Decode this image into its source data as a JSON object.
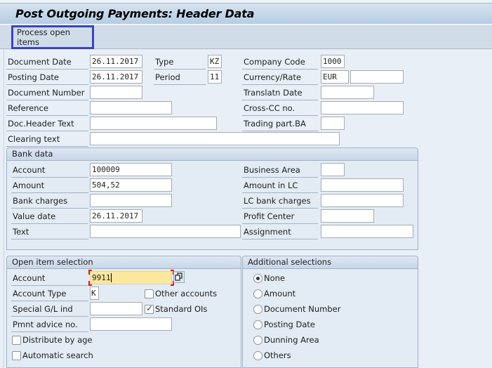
{
  "window": {
    "title": "Post Outgoing Payments: Header Data"
  },
  "toolbar": {
    "process_open_items": "Process open items"
  },
  "header": {
    "document_date": {
      "label": "Document Date",
      "value": "26.11.2017"
    },
    "type": {
      "label": "Type",
      "value": "KZ"
    },
    "company_code": {
      "label": "Company Code",
      "value": "1000"
    },
    "posting_date": {
      "label": "Posting Date",
      "value": "26.11.2017"
    },
    "period": {
      "label": "Period",
      "value": "11"
    },
    "currency_rate": {
      "label": "Currency/Rate",
      "currency": "EUR",
      "rate": ""
    },
    "document_number": {
      "label": "Document Number",
      "value": ""
    },
    "translatn_date": {
      "label": "Translatn Date",
      "value": ""
    },
    "reference": {
      "label": "Reference",
      "value": ""
    },
    "cross_cc_no": {
      "label": "Cross-CC no.",
      "value": ""
    },
    "doc_header_text": {
      "label": "Doc.Header Text",
      "value": ""
    },
    "trading_part_ba": {
      "label": "Trading part.BA",
      "value": ""
    },
    "clearing_text": {
      "label": "Clearing text",
      "value": ""
    }
  },
  "bank_data": {
    "title": "Bank data",
    "account": {
      "label": "Account",
      "value": "100009"
    },
    "amount": {
      "label": "Amount",
      "value": "504,52"
    },
    "bank_charges": {
      "label": "Bank charges",
      "value": ""
    },
    "value_date": {
      "label": "Value date",
      "value": "26.11.2017"
    },
    "text": {
      "label": "Text",
      "value": ""
    },
    "business_area": {
      "label": "Business Area",
      "value": ""
    },
    "amount_in_lc": {
      "label": "Amount in LC",
      "value": ""
    },
    "lc_bank_charges": {
      "label": "LC bank charges",
      "value": ""
    },
    "profit_center": {
      "label": "Profit Center",
      "value": ""
    },
    "assignment": {
      "label": "Assignment",
      "value": ""
    }
  },
  "open_item_selection": {
    "title": "Open item selection",
    "account": {
      "label": "Account",
      "value": "9911"
    },
    "account_type": {
      "label": "Account Type",
      "value": "K"
    },
    "other_accounts": {
      "label": "Other accounts",
      "checked": false
    },
    "special_gl_ind": {
      "label": "Special G/L ind",
      "value": ""
    },
    "standard_ois": {
      "label": "Standard OIs",
      "checked": true
    },
    "pmnt_advice_no": {
      "label": "Pmnt advice no.",
      "value": ""
    },
    "distribute_by_age": {
      "label": "Distribute by age",
      "checked": false
    },
    "automatic_search": {
      "label": "Automatic search",
      "checked": false
    }
  },
  "additional_selections": {
    "title": "Additional selections",
    "selected": "None",
    "options": [
      "None",
      "Amount",
      "Document Number",
      "Posting Date",
      "Dunning Area",
      "Others"
    ]
  },
  "icons": {
    "multiple_selection": "multiple-selection-icon",
    "check": "checkmark-icon"
  }
}
